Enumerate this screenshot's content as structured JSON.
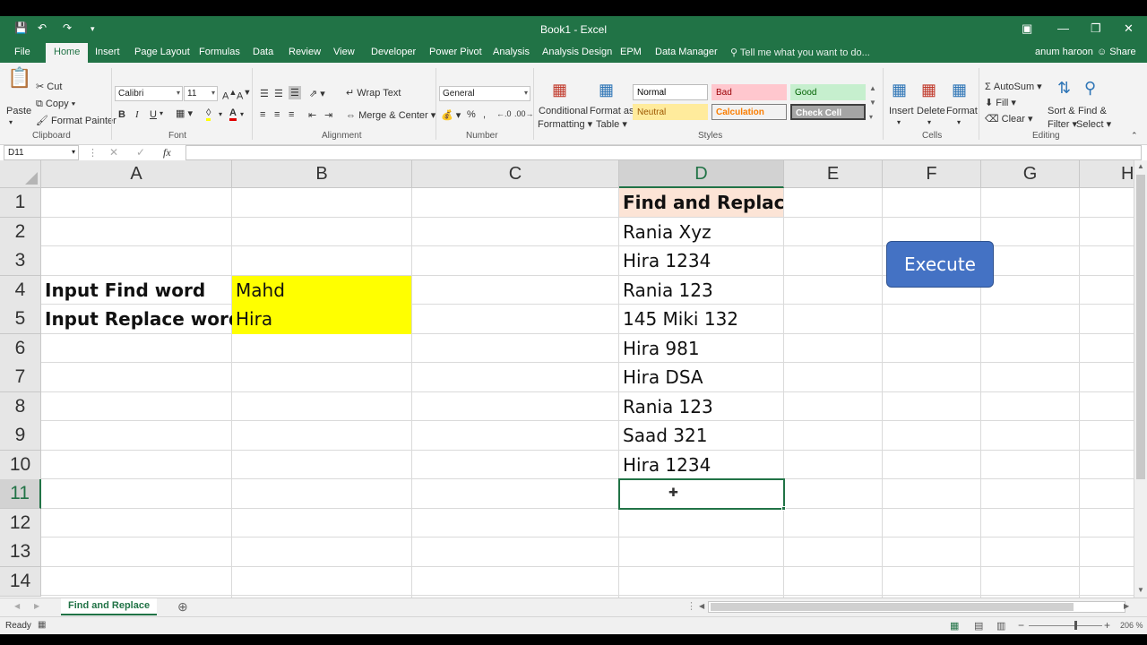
{
  "app": {
    "title": "Book1 - Excel",
    "user": "anum haroon",
    "share_label": "Share",
    "tell_me": "Tell me what you want to do..."
  },
  "tabs": [
    "File",
    "Home",
    "Insert",
    "Page Layout",
    "Formulas",
    "Data",
    "Review",
    "View",
    "Developer",
    "Power Pivot",
    "Analysis",
    "Analysis Design",
    "EPM",
    "Data Manager"
  ],
  "active_tab": "Home",
  "ribbon": {
    "clipboard": {
      "paste": "Paste",
      "cut": "Cut",
      "copy": "Copy",
      "format_painter": "Format Painter",
      "label": "Clipboard"
    },
    "font": {
      "name": "Calibri",
      "size": "11",
      "bold": "B",
      "italic": "I",
      "underline": "U",
      "label": "Font"
    },
    "alignment": {
      "wrap_text": "Wrap Text",
      "merge_center": "Merge & Center",
      "label": "Alignment"
    },
    "number": {
      "format": "General",
      "label": "Number"
    },
    "styles": {
      "conditional_1": "Conditional",
      "conditional_2": "Formatting",
      "format_as_1": "Format as",
      "format_as_2": "Table",
      "normal": "Normal",
      "bad": "Bad",
      "good": "Good",
      "neutral": "Neutral",
      "calculation": "Calculation",
      "check_cell": "Check Cell",
      "label": "Styles"
    },
    "cells": {
      "insert": "Insert",
      "delete": "Delete",
      "format": "Format",
      "label": "Cells"
    },
    "editing": {
      "autosum": "AutoSum",
      "fill": "Fill",
      "clear": "Clear",
      "sort_1": "Sort &",
      "sort_2": "Filter",
      "find_1": "Find &",
      "find_2": "Select",
      "label": "Editing"
    }
  },
  "formula_bar": {
    "name_box": "D11",
    "fx": "fx",
    "content": ""
  },
  "columns": [
    "A",
    "B",
    "C",
    "D",
    "E",
    "F",
    "G",
    "H"
  ],
  "rows": [
    "1",
    "2",
    "3",
    "4",
    "5",
    "6",
    "7",
    "8",
    "9",
    "10",
    "11",
    "12",
    "13",
    "14"
  ],
  "cells": {
    "a4": "Input Find word",
    "a5": "Input Replace word",
    "b4": "Mahd",
    "b5": "Hira",
    "d1": "Find and Replace",
    "d2": "Rania Xyz",
    "d3": "Hira 1234",
    "d4": "Rania 123",
    "d5": "145 Miki 132",
    "d6": "Hira 981",
    "d7": "Hira DSA",
    "d8": "Rania 123",
    "d9": "Saad 321",
    "d10": "Hira 1234"
  },
  "selected_cell": "D11",
  "execute_button": "Execute",
  "sheet_tab": "Find and Replace",
  "status": {
    "ready": "Ready",
    "zoom": "206 %"
  },
  "colors": {
    "excel_green": "#217346",
    "highlight_yellow": "#ffff00",
    "header_fill": "#fce4d6",
    "button_blue": "#4472c4"
  }
}
